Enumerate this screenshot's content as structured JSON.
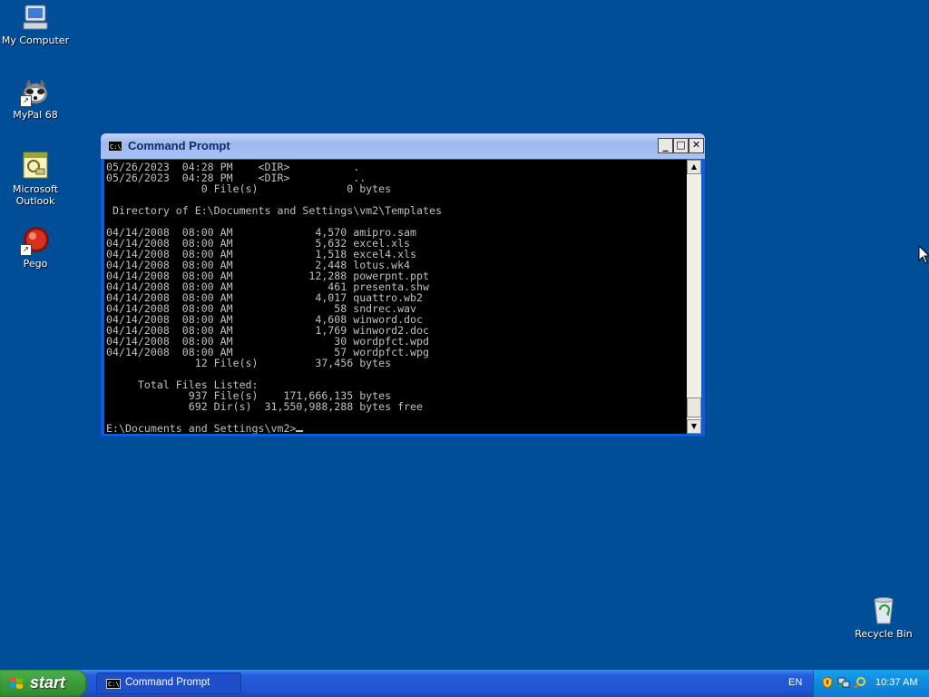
{
  "desktop": {
    "background_color": "#004e98",
    "icons": [
      {
        "label": "My Computer",
        "icon": "computer-icon"
      },
      {
        "label": "MyPal 68",
        "icon": "raccoon-icon"
      },
      {
        "label_line1": "Microsoft",
        "label_line2": "Outlook",
        "icon": "outlook-icon"
      },
      {
        "label": "Pego",
        "icon": "red-ball-icon"
      }
    ],
    "recycle_bin": {
      "label": "Recycle Bin",
      "icon": "recycle-bin-icon"
    }
  },
  "window": {
    "title": "Command Prompt",
    "icon_text": "C:\\",
    "minimize": "_",
    "maximize": "□",
    "close": "✕",
    "console_lines": [
      "05/26/2023  04:28 PM    <DIR>          .",
      "05/26/2023  04:28 PM    <DIR>          ..",
      "               0 File(s)              0 bytes",
      "",
      " Directory of E:\\Documents and Settings\\vm2\\Templates",
      "",
      "04/14/2008  08:00 AM             4,570 amipro.sam",
      "04/14/2008  08:00 AM             5,632 excel.xls",
      "04/14/2008  08:00 AM             1,518 excel4.xls",
      "04/14/2008  08:00 AM             2,448 lotus.wk4",
      "04/14/2008  08:00 AM            12,288 powerpnt.ppt",
      "04/14/2008  08:00 AM               461 presenta.shw",
      "04/14/2008  08:00 AM             4,017 quattro.wb2",
      "04/14/2008  08:00 AM                58 sndrec.wav",
      "04/14/2008  08:00 AM             4,608 winword.doc",
      "04/14/2008  08:00 AM             1,769 winword2.doc",
      "04/14/2008  08:00 AM                30 wordpfct.wpd",
      "04/14/2008  08:00 AM                57 wordpfct.wpg",
      "              12 File(s)         37,456 bytes",
      "",
      "     Total Files Listed:",
      "             937 File(s)    171,666,135 bytes",
      "             692 Dir(s)  31,550,988,288 bytes free",
      ""
    ],
    "prompt": "E:\\Documents and Settings\\vm2>"
  },
  "taskbar": {
    "start_label": "start",
    "task_item_label": "Command Prompt",
    "task_item_icon_text": "C:\\",
    "language": "EN",
    "clock": "10:37 AM",
    "tray_icons": [
      "security-shield-icon",
      "network-icon",
      "search-icon"
    ]
  }
}
